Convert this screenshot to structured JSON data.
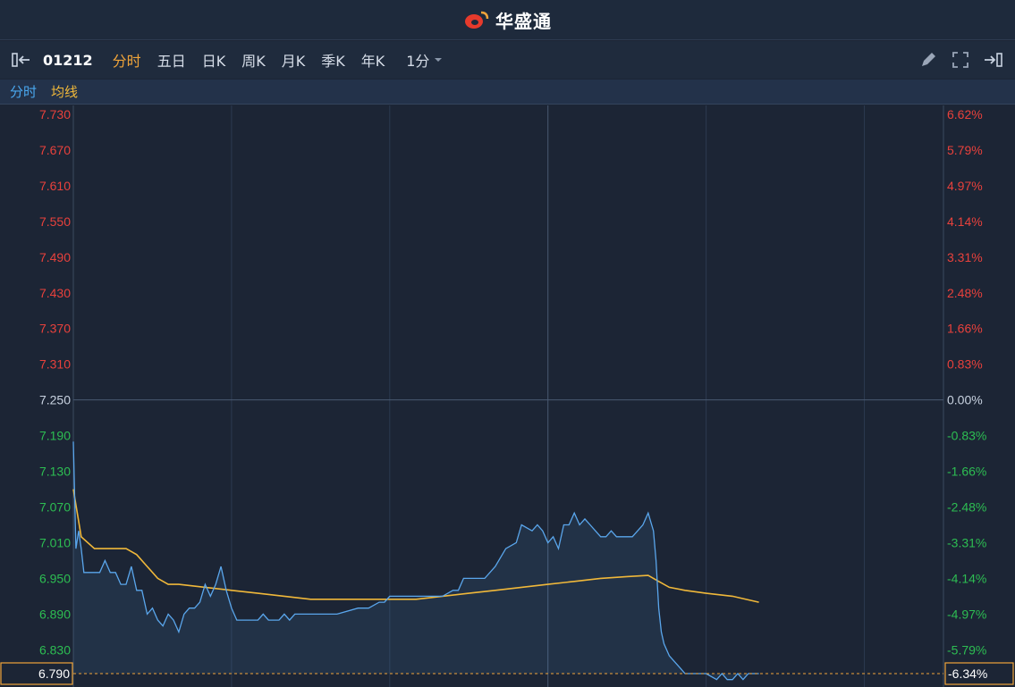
{
  "app": {
    "name": "华盛通"
  },
  "toolbar": {
    "code": "01212",
    "tabs": [
      "分时",
      "五日",
      "日K",
      "周K",
      "月K",
      "季K",
      "年K"
    ],
    "active_tab": 0,
    "interval": "1分"
  },
  "legend": {
    "price_label": "分时",
    "avg_label": "均线"
  },
  "colors": {
    "up": "#e8413c",
    "down": "#2dbd52",
    "neutral": "#c8d2e0",
    "price_line": "#5aa6ec",
    "avg_line": "#f0b83a",
    "highlight_box": "#f0a43a"
  },
  "chart_data": {
    "type": "line",
    "prev_close": 7.25,
    "ylim": [
      6.79,
      7.73
    ],
    "y_ticks": [
      "7.730",
      "7.670",
      "7.610",
      "7.550",
      "7.490",
      "7.430",
      "7.370",
      "7.310",
      "7.250",
      "7.190",
      "7.130",
      "7.070",
      "7.010",
      "6.950",
      "6.890",
      "6.830"
    ],
    "pct_ticks": [
      "6.62%",
      "5.79%",
      "4.97%",
      "4.14%",
      "3.31%",
      "2.48%",
      "1.66%",
      "0.83%",
      "0.00%",
      "-0.83%",
      "-1.66%",
      "-2.48%",
      "-3.31%",
      "-4.14%",
      "-4.97%",
      "-5.79%"
    ],
    "current": {
      "price": "6.790",
      "pct": "-6.34%"
    },
    "x_total_minutes": 330,
    "series": [
      {
        "values": [
          [
            0,
            7.18
          ],
          [
            1,
            7.0
          ],
          [
            2,
            7.03
          ],
          [
            3,
            7.0
          ],
          [
            4,
            6.96
          ],
          [
            6,
            6.96
          ],
          [
            10,
            6.96
          ],
          [
            12,
            6.98
          ],
          [
            14,
            6.96
          ],
          [
            16,
            6.96
          ],
          [
            18,
            6.94
          ],
          [
            20,
            6.94
          ],
          [
            22,
            6.97
          ],
          [
            24,
            6.93
          ],
          [
            26,
            6.93
          ],
          [
            28,
            6.89
          ],
          [
            30,
            6.9
          ],
          [
            32,
            6.88
          ],
          [
            34,
            6.87
          ],
          [
            36,
            6.89
          ],
          [
            38,
            6.88
          ],
          [
            40,
            6.86
          ],
          [
            42,
            6.89
          ],
          [
            44,
            6.9
          ],
          [
            46,
            6.9
          ],
          [
            48,
            6.91
          ],
          [
            50,
            6.94
          ],
          [
            52,
            6.92
          ],
          [
            54,
            6.94
          ],
          [
            56,
            6.97
          ],
          [
            58,
            6.93
          ],
          [
            60,
            6.9
          ],
          [
            62,
            6.88
          ],
          [
            64,
            6.88
          ],
          [
            70,
            6.88
          ],
          [
            72,
            6.89
          ],
          [
            74,
            6.88
          ],
          [
            78,
            6.88
          ],
          [
            80,
            6.89
          ],
          [
            82,
            6.88
          ],
          [
            84,
            6.89
          ],
          [
            90,
            6.89
          ],
          [
            100,
            6.89
          ],
          [
            108,
            6.9
          ],
          [
            112,
            6.9
          ],
          [
            116,
            6.91
          ],
          [
            118,
            6.91
          ],
          [
            120,
            6.92
          ],
          [
            124,
            6.92
          ],
          [
            128,
            6.92
          ],
          [
            132,
            6.92
          ],
          [
            136,
            6.92
          ],
          [
            140,
            6.92
          ],
          [
            144,
            6.93
          ],
          [
            146,
            6.93
          ],
          [
            148,
            6.95
          ],
          [
            152,
            6.95
          ],
          [
            156,
            6.95
          ],
          [
            160,
            6.97
          ],
          [
            164,
            7.0
          ],
          [
            168,
            7.01
          ],
          [
            170,
            7.04
          ],
          [
            174,
            7.03
          ],
          [
            176,
            7.04
          ],
          [
            178,
            7.03
          ],
          [
            180,
            7.01
          ],
          [
            182,
            7.02
          ],
          [
            184,
            7.0
          ],
          [
            186,
            7.04
          ],
          [
            188,
            7.04
          ],
          [
            190,
            7.06
          ],
          [
            192,
            7.04
          ],
          [
            194,
            7.05
          ],
          [
            196,
            7.04
          ],
          [
            198,
            7.03
          ],
          [
            200,
            7.02
          ],
          [
            202,
            7.02
          ],
          [
            204,
            7.03
          ],
          [
            206,
            7.02
          ],
          [
            208,
            7.02
          ],
          [
            210,
            7.02
          ],
          [
            212,
            7.02
          ],
          [
            214,
            7.03
          ],
          [
            216,
            7.04
          ],
          [
            218,
            7.06
          ],
          [
            220,
            7.03
          ],
          [
            221,
            6.98
          ],
          [
            222,
            6.9
          ],
          [
            223,
            6.86
          ],
          [
            224,
            6.84
          ],
          [
            226,
            6.82
          ],
          [
            228,
            6.81
          ],
          [
            230,
            6.8
          ],
          [
            232,
            6.79
          ],
          [
            236,
            6.79
          ],
          [
            240,
            6.79
          ],
          [
            244,
            6.78
          ],
          [
            246,
            6.79
          ],
          [
            248,
            6.78
          ],
          [
            250,
            6.78
          ],
          [
            252,
            6.79
          ],
          [
            254,
            6.78
          ],
          [
            256,
            6.79
          ],
          [
            260,
            6.79
          ]
        ]
      },
      {
        "values": [
          [
            0,
            7.1
          ],
          [
            3,
            7.02
          ],
          [
            8,
            7.0
          ],
          [
            14,
            7.0
          ],
          [
            20,
            7.0
          ],
          [
            24,
            6.99
          ],
          [
            28,
            6.97
          ],
          [
            32,
            6.95
          ],
          [
            36,
            6.94
          ],
          [
            40,
            6.94
          ],
          [
            50,
            6.935
          ],
          [
            60,
            6.93
          ],
          [
            70,
            6.925
          ],
          [
            80,
            6.92
          ],
          [
            90,
            6.915
          ],
          [
            100,
            6.915
          ],
          [
            110,
            6.915
          ],
          [
            120,
            6.915
          ],
          [
            130,
            6.915
          ],
          [
            140,
            6.92
          ],
          [
            150,
            6.925
          ],
          [
            160,
            6.93
          ],
          [
            170,
            6.935
          ],
          [
            180,
            6.94
          ],
          [
            190,
            6.945
          ],
          [
            200,
            6.95
          ],
          [
            210,
            6.953
          ],
          [
            218,
            6.955
          ],
          [
            222,
            6.945
          ],
          [
            226,
            6.935
          ],
          [
            232,
            6.93
          ],
          [
            240,
            6.925
          ],
          [
            250,
            6.92
          ],
          [
            260,
            6.91
          ]
        ]
      }
    ]
  }
}
